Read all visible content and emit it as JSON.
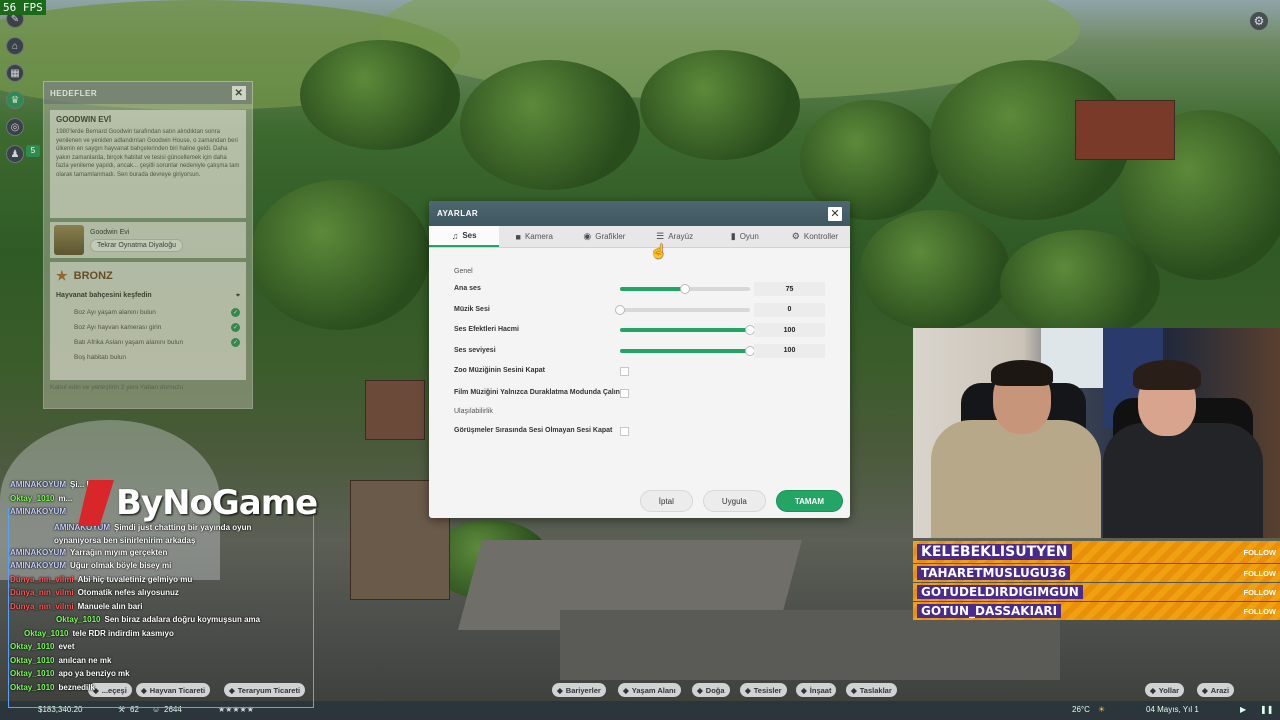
{
  "hud": {
    "fps": "56 FPS",
    "badge": "5",
    "left_icons": [
      "edit-icon",
      "research-icon",
      "calendar-icon",
      "trophy-icon",
      "globe-icon",
      "worker-icon"
    ]
  },
  "objectives": {
    "title": "HEDEFLER",
    "close": "✕",
    "card_title": "GOODWIN EVİ",
    "card_text": "1980'lerde Bernard Goodwin tarafından satın alındıktan sonra yenilenen ve yeniden adlandırılan Goodwin House, o zamandan beri ülkenin en saygın hayvanat bahçelerinden biri haline geldi. Daha yakın zamanlarda, birçok habitat ve tesisi güncellemek için daha fazla yenileme yapıldı, ancak... çeşitli sorunlar nedeniyle çalışma tam olarak tamamlanmadı. Sen burada devreye giriyorsun.",
    "person_name": "Goodwin Evi",
    "replay_button": "Tekrar Oynatma Diyaloğu",
    "bronze_title": "BRONZ",
    "task_group": "Hayvanat bahçesini keşfedin",
    "tasks": [
      {
        "label": "Boz Ayı yaşam alanını bulun",
        "done": true
      },
      {
        "label": "Boz Ayı hayvan kamerası girin",
        "done": true
      },
      {
        "label": "Batı Afrika Aslanı yaşam alanını bulun",
        "done": true
      },
      {
        "label": "Boş habitatı bulun",
        "done": false
      }
    ],
    "footer": "Kabul edin ve yerleştirin 2 yeni Yaban domuzu"
  },
  "settings": {
    "title": "AYARLAR",
    "close": "✕",
    "tabs": [
      {
        "label": "Ses",
        "icon": "music-icon",
        "glyph": "♫",
        "active": true
      },
      {
        "label": "Kamera",
        "icon": "camera-icon",
        "glyph": "■",
        "active": false
      },
      {
        "label": "Grafikler",
        "icon": "palette-icon",
        "glyph": "◉",
        "active": false
      },
      {
        "label": "Arayüz",
        "icon": "list-icon",
        "glyph": "☰",
        "active": false
      },
      {
        "label": "Oyun",
        "icon": "bar-chart-icon",
        "glyph": "▮",
        "active": false
      },
      {
        "label": "Kontroller",
        "icon": "gear-icon",
        "glyph": "⚙",
        "active": false
      }
    ],
    "section_general": "Genel",
    "sliders": [
      {
        "label": "Ana ses",
        "value": "75",
        "level": 0.5
      },
      {
        "label": "Müzik Sesi",
        "value": "0",
        "level": 0.0
      },
      {
        "label": "Ses Efektleri Hacmi",
        "value": "100",
        "level": 1.0
      },
      {
        "label": "Ses seviyesi",
        "value": "100",
        "level": 1.0
      }
    ],
    "mute_zoo_music": "Zoo Müziğinin Sesini Kapat",
    "film_music_pause": "Film Müziğini Yalnızca Duraklatma Modunda Çalın",
    "section_accessibility": "Ulaşılabilirlik",
    "silent_conversations": "Görüşmeler Sırasında Sesi Olmayan Sesi Kapat",
    "buttons": {
      "cancel": "İptal",
      "apply": "Uygula",
      "ok": "TAMAM"
    },
    "accent": "#23a566"
  },
  "stream": {
    "logo": "ByNoGame",
    "follows": [
      {
        "name": "KELEBEKLISUTYEN",
        "tag": "FOLLOW"
      },
      {
        "name": "TAHARETMUSLUGU36",
        "tag": "FOLLOW"
      },
      {
        "name": "GOTUDELDIRDIGIMGUN",
        "tag": "FOLLOW"
      },
      {
        "name": "GOTUN_DASSAKIARI",
        "tag": "FOLLOW"
      }
    ],
    "chat": [
      {
        "user": "AMINAKOYUM",
        "color": "#c8d0ff",
        "text": "Şi... benim"
      },
      {
        "user": "Oktay_1010",
        "color": "#7dff5a",
        "text": "m..."
      },
      {
        "user": "AMINAKOYUM",
        "color": "#c8d0ff",
        "text": ""
      },
      {
        "user": "AMINAKOYUM",
        "color": "#c8d0ff",
        "text": "Şimdi just chatting bir yayında oyun oynanıyorsa ben sinirlenirim arkadaş"
      },
      {
        "user": "AMINAKOYUM",
        "color": "#c8d0ff",
        "text": "Yarrağın mıyım gerçekten"
      },
      {
        "user": "AMINAKOYUM",
        "color": "#c8d0ff",
        "text": "Uğur olmak böyle bisey mi"
      },
      {
        "user": "Dünya_nın_vilmi",
        "color": "#ff5a5a",
        "text": "Abi hiç tuvaletiniz gelmiyo mu"
      },
      {
        "user": "Dünya_nın_vilmi",
        "color": "#ff5a5a",
        "text": "Otomatik nefes alıyosunuz"
      },
      {
        "user": "Dünya_nın_vilmi",
        "color": "#ff5a5a",
        "text": "Manuele alın bari"
      },
      {
        "user": "Oktay_1010",
        "color": "#7dff5a",
        "text": "Sen biraz adalara doğru koymuşsun ama"
      },
      {
        "user": "Oktay_1010",
        "color": "#7dff5a",
        "text": "tele RDR indirdim kasmıyo"
      },
      {
        "user": "Oktay_1010",
        "color": "#7dff5a",
        "text": "evet"
      },
      {
        "user": "Oktay_1010",
        "color": "#7dff5a",
        "text": "anılcan ne mk"
      },
      {
        "user": "Oktay_1010",
        "color": "#7dff5a",
        "text": "apo ya benziyo mk"
      },
      {
        "user": "Oktay_1010",
        "color": "#7dff5a",
        "text": "beznedilk"
      }
    ]
  },
  "bottom": {
    "categories_left": [
      "...eçeşi",
      "Hayvan Ticareti",
      "Teraryum Ticareti"
    ],
    "categories_mid": [
      "Bariyerler",
      "Yaşam Alanı",
      "Doğa",
      "Tesisler",
      "İnşaat",
      "Taslaklar"
    ],
    "categories_right": [
      "Yollar",
      "Arazi"
    ],
    "money": "$183,340.20",
    "staff": "62",
    "guests": "2644",
    "rating": "★★★★★",
    "temperature": "26°C",
    "date": "04 Mayıs, Yıl 1"
  }
}
